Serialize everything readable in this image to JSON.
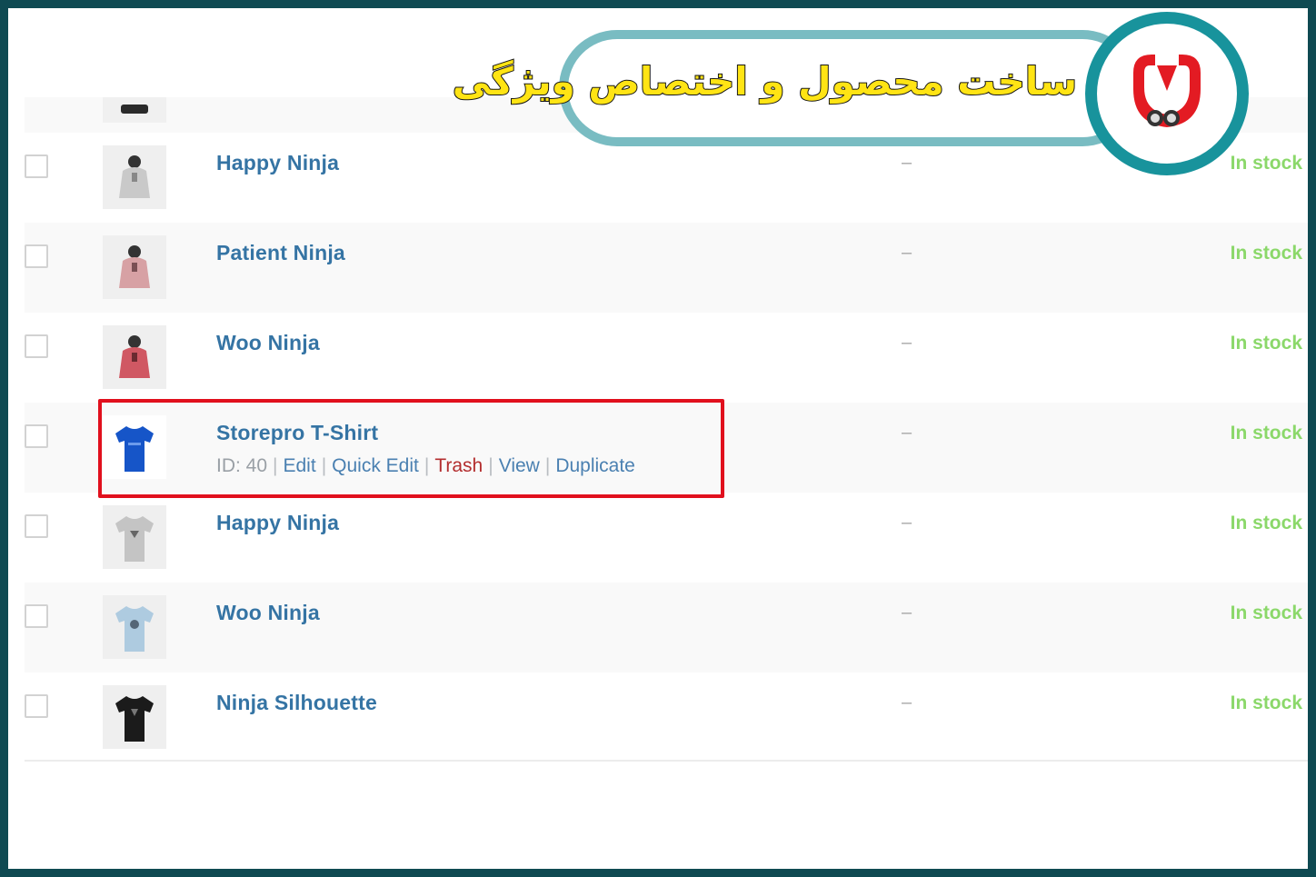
{
  "banner": {
    "title": "ساخت محصول و اختصاص ویژگی",
    "colors": {
      "text": "#ffe414",
      "outline": "#79bcc2",
      "logo_ring": "#18939c",
      "logo_mark": "#e31b23"
    }
  },
  "products": [
    {
      "name": "Happy Ninja",
      "price": "–",
      "stock": "In stock",
      "thumb": "hoodie-grey-icon"
    },
    {
      "name": "Patient Ninja",
      "price": "–",
      "stock": "In stock",
      "thumb": "hoodie-pink-icon"
    },
    {
      "name": "Woo Ninja",
      "price": "–",
      "stock": "In stock",
      "thumb": "hoodie-red-icon"
    },
    {
      "name": "Storepro T-Shirt",
      "price": "–",
      "stock": "In stock",
      "thumb": "tshirt-blue-icon",
      "row_actions": {
        "id_label": "ID: 40",
        "edit": "Edit",
        "quick_edit": "Quick Edit",
        "trash": "Trash",
        "view": "View",
        "duplicate": "Duplicate",
        "separator": "|"
      }
    },
    {
      "name": "Happy Ninja",
      "price": "–",
      "stock": "In stock",
      "thumb": "tshirt-grey-icon"
    },
    {
      "name": "Woo Ninja",
      "price": "–",
      "stock": "In stock",
      "thumb": "tshirt-lightblue-icon"
    },
    {
      "name": "Ninja Silhouette",
      "price": "–",
      "stock": "In stock",
      "thumb": "tshirt-black-icon"
    }
  ],
  "colors": {
    "link": "#3574a4",
    "in_stock": "#8bd86a",
    "trash": "#b32d2e",
    "highlight": "#e1101d"
  }
}
